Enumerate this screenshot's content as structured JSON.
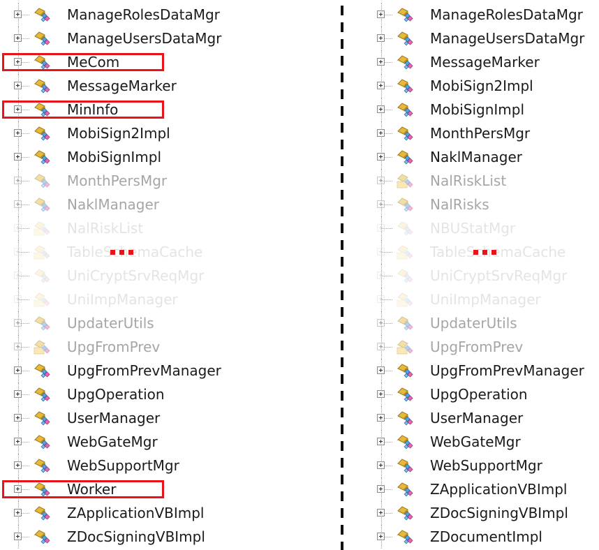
{
  "left_tree": {
    "items": [
      {
        "label": "ManageRolesDataMgr",
        "state": "normal"
      },
      {
        "label": "ManageUsersDataMgr",
        "state": "normal"
      },
      {
        "label": "MeCom",
        "state": "normal",
        "highlighted": true
      },
      {
        "label": "MessageMarker",
        "state": "normal"
      },
      {
        "label": "MinInfo",
        "state": "normal",
        "highlighted": true
      },
      {
        "label": "MobiSign2Impl",
        "state": "normal"
      },
      {
        "label": "MobiSignImpl",
        "state": "normal"
      },
      {
        "label": "MonthPersMgr",
        "state": "dim"
      },
      {
        "label": "NaklManager",
        "state": "dim"
      },
      {
        "label": "NalRiskList",
        "state": "faint",
        "icon": "folder"
      },
      {
        "label": "TableSchemaCache",
        "state": "faint",
        "icon": "folder"
      },
      {
        "label": "UniCryptSrvReqMgr",
        "state": "faint"
      },
      {
        "label": "UniImpManager",
        "state": "faint",
        "icon": "folder"
      },
      {
        "label": "UpdaterUtils",
        "state": "dim"
      },
      {
        "label": "UpgFromPrev",
        "state": "dim",
        "icon": "folder"
      },
      {
        "label": "UpgFromPrevManager",
        "state": "normal"
      },
      {
        "label": "UpgOperation",
        "state": "normal"
      },
      {
        "label": "UserManager",
        "state": "normal"
      },
      {
        "label": "WebGateMgr",
        "state": "normal"
      },
      {
        "label": "WebSupportMgr",
        "state": "normal"
      },
      {
        "label": "Worker",
        "state": "normal",
        "highlighted": true
      },
      {
        "label": "ZApplicationVBImpl",
        "state": "normal"
      },
      {
        "label": "ZDocSigningVBImpl",
        "state": "normal"
      }
    ]
  },
  "right_tree": {
    "items": [
      {
        "label": "ManageRolesDataMgr",
        "state": "normal"
      },
      {
        "label": "ManageUsersDataMgr",
        "state": "normal"
      },
      {
        "label": "MessageMarker",
        "state": "normal"
      },
      {
        "label": "MobiSign2Impl",
        "state": "normal"
      },
      {
        "label": "MobiSignImpl",
        "state": "normal"
      },
      {
        "label": "MonthPersMgr",
        "state": "normal"
      },
      {
        "label": "NaklManager",
        "state": "normal"
      },
      {
        "label": "NalRiskList",
        "state": "dim",
        "icon": "folder"
      },
      {
        "label": "NalRisks",
        "state": "dim"
      },
      {
        "label": "NBUStatMgr",
        "state": "faint"
      },
      {
        "label": "TableSchemaCache",
        "state": "faint",
        "icon": "folder"
      },
      {
        "label": "UniCryptSrvReqMgr",
        "state": "faint"
      },
      {
        "label": "UniImpManager",
        "state": "faint",
        "icon": "folder"
      },
      {
        "label": "UpdaterUtils",
        "state": "dim"
      },
      {
        "label": "UpgFromPrev",
        "state": "dim",
        "icon": "folder"
      },
      {
        "label": "UpgFromPrevManager",
        "state": "normal"
      },
      {
        "label": "UpgOperation",
        "state": "normal"
      },
      {
        "label": "UserManager",
        "state": "normal"
      },
      {
        "label": "WebGateMgr",
        "state": "normal"
      },
      {
        "label": "WebSupportMgr",
        "state": "normal"
      },
      {
        "label": "ZApplicationVBImpl",
        "state": "normal"
      },
      {
        "label": "ZDocSigningVBImpl",
        "state": "normal"
      },
      {
        "label": "ZDocumentImpl",
        "state": "normal"
      }
    ]
  },
  "colors": {
    "highlight_border": "#e8141a",
    "text": "#1a1a1a",
    "dim_text": "#a6a6a6",
    "faint_text": "#e4e4e4",
    "divider": "#111111"
  },
  "icons": {
    "expander": "plus-box-icon",
    "component": "component-icon",
    "folder": "folder-component-icon"
  }
}
